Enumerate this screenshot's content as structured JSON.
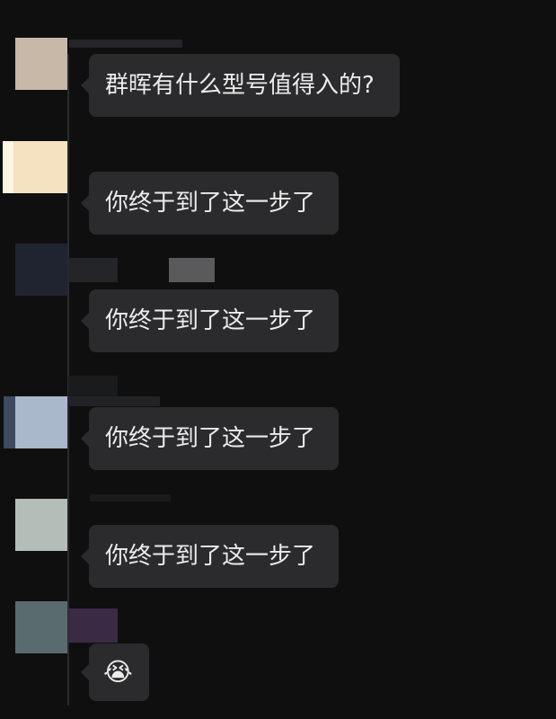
{
  "messages": [
    {
      "text": "群晖有什么型号值得入的?",
      "avatar_color": "#c8b8a8"
    },
    {
      "text": "你终于到了这一步了",
      "avatar_color": "#f4e2c0"
    },
    {
      "text": "你终于到了这一步了",
      "avatar_color": "#1f2430"
    },
    {
      "text": "你终于到了这一步了",
      "avatar_color": "#aab8cc"
    },
    {
      "text": "你终于到了这一步了",
      "avatar_color": "#b5bdb8"
    },
    {
      "text": "😭",
      "avatar_color": "#596b6e"
    }
  ]
}
